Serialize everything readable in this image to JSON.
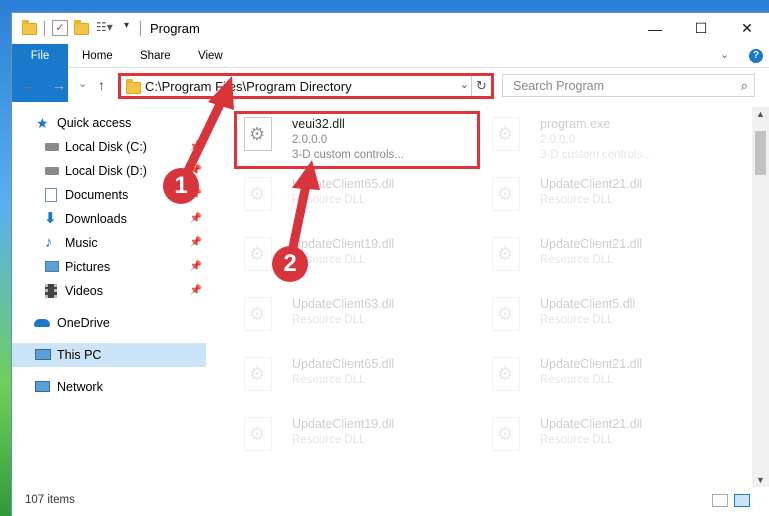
{
  "window": {
    "title": "Program",
    "minimize": "—",
    "maximize": "☐",
    "close": "✕"
  },
  "ribbon": {
    "tabs": [
      "File",
      "Home",
      "Share",
      "View"
    ],
    "expand": "⌄",
    "help": "?"
  },
  "address_bar": {
    "path": "C:\\Program Files\\Program Directory",
    "back": "←",
    "forward": "→",
    "recent": "⌄",
    "up": "↑",
    "dropdown": "⌄",
    "refresh": "↻"
  },
  "search": {
    "placeholder": "Search Program"
  },
  "nav_pane": {
    "items": [
      {
        "label": "Quick access",
        "icon": "star-icon",
        "pinned": false
      },
      {
        "label": "Local Disk (C:)",
        "icon": "drive-icon",
        "pinned": true
      },
      {
        "label": "Local Disk (D:)",
        "icon": "drive-icon",
        "pinned": true
      },
      {
        "label": "Documents",
        "icon": "documents-icon",
        "pinned": true
      },
      {
        "label": "Downloads",
        "icon": "download-icon",
        "pinned": true
      },
      {
        "label": "Music",
        "icon": "music-icon",
        "pinned": true
      },
      {
        "label": "Pictures",
        "icon": "pictures-icon",
        "pinned": true
      },
      {
        "label": "Videos",
        "icon": "videos-icon",
        "pinned": true
      },
      {
        "label": "OneDrive",
        "icon": "cloud-icon",
        "pinned": false
      },
      {
        "label": "This PC",
        "icon": "computer-icon",
        "pinned": false,
        "selected": true
      },
      {
        "label": "Network",
        "icon": "network-icon",
        "pinned": false
      }
    ],
    "pin_glyph": "📌"
  },
  "files": {
    "highlighted": {
      "name": "veui32.dll",
      "version": "2.0.0.0",
      "description": "3-D custom controls..."
    },
    "program": {
      "name": "program.exe",
      "version": "2.0.0.0",
      "description": "3-D custom controls..."
    },
    "left_column": [
      {
        "name": "UpdateClient65.dll",
        "type": "Resource DLL"
      },
      {
        "name": "UpdateClient19.dll",
        "type": "Resource DLL"
      },
      {
        "name": "UpdateClient63.dll",
        "type": "Resource DLL"
      },
      {
        "name": "UpdateClient65.dll",
        "type": "Resource DLL"
      },
      {
        "name": "UpdateClient19.dll",
        "type": "Resource DLL"
      }
    ],
    "right_column": [
      {
        "name": "UpdateClient21.dll",
        "type": "Resource DLL"
      },
      {
        "name": "UpdateClient21.dll",
        "type": "Resource DLL"
      },
      {
        "name": "UpdateClient5.dll",
        "type": "Resource DLL"
      },
      {
        "name": "UpdateClient21.dll",
        "type": "Resource DLL"
      },
      {
        "name": "UpdateClient21.dll",
        "type": "Resource DLL"
      }
    ]
  },
  "status_bar": {
    "item_count": "107 items"
  },
  "callouts": [
    "1",
    "2"
  ],
  "colors": {
    "accent": "#1979ca",
    "highlight": "#e0343b",
    "callout": "#d8343b",
    "selected": "#cce4f7"
  }
}
